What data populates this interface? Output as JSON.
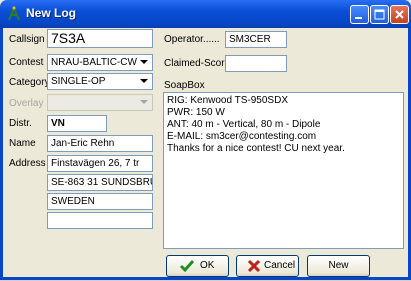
{
  "window": {
    "title": "New Log"
  },
  "form": {
    "callsign_label": "Callsign",
    "callsign_value": "7S3A",
    "contest_label": "Contest",
    "contest_value": "NRAU-BALTIC-CW",
    "category_label": "Category",
    "category_value": "SINGLE-OP",
    "overlay_label": "Overlay",
    "overlay_value": "",
    "distr_label": "Distr.",
    "distr_value": "VN",
    "name_label": "Name",
    "name_value": "Jan-Eric Rehn",
    "address_label": "Address",
    "address_lines": [
      "Finstavägen 26, 7 tr",
      "SE-863 31 SUNDSBRU",
      "SWEDEN",
      ""
    ],
    "operator_label": "Operator......",
    "operator_value": "SM3CER",
    "claimed_label": "Claimed-Score",
    "claimed_value": "",
    "soapbox_label": "SoapBox",
    "soapbox_lines": [
      "RIG: Kenwood TS-950SDX",
      "PWR: 150 W",
      "ANT: 40 m - Vertical, 80 m - Dipole",
      "E-MAIL: sm3cer@contesting.com",
      "Thanks for a nice contest! CU next year."
    ]
  },
  "buttons": {
    "ok": "OK",
    "cancel": "Cancel",
    "new": "New"
  },
  "colors": {
    "titlebar": "#0846c6",
    "window_bg": "#ece9d8",
    "field_border": "#7f9db9"
  }
}
